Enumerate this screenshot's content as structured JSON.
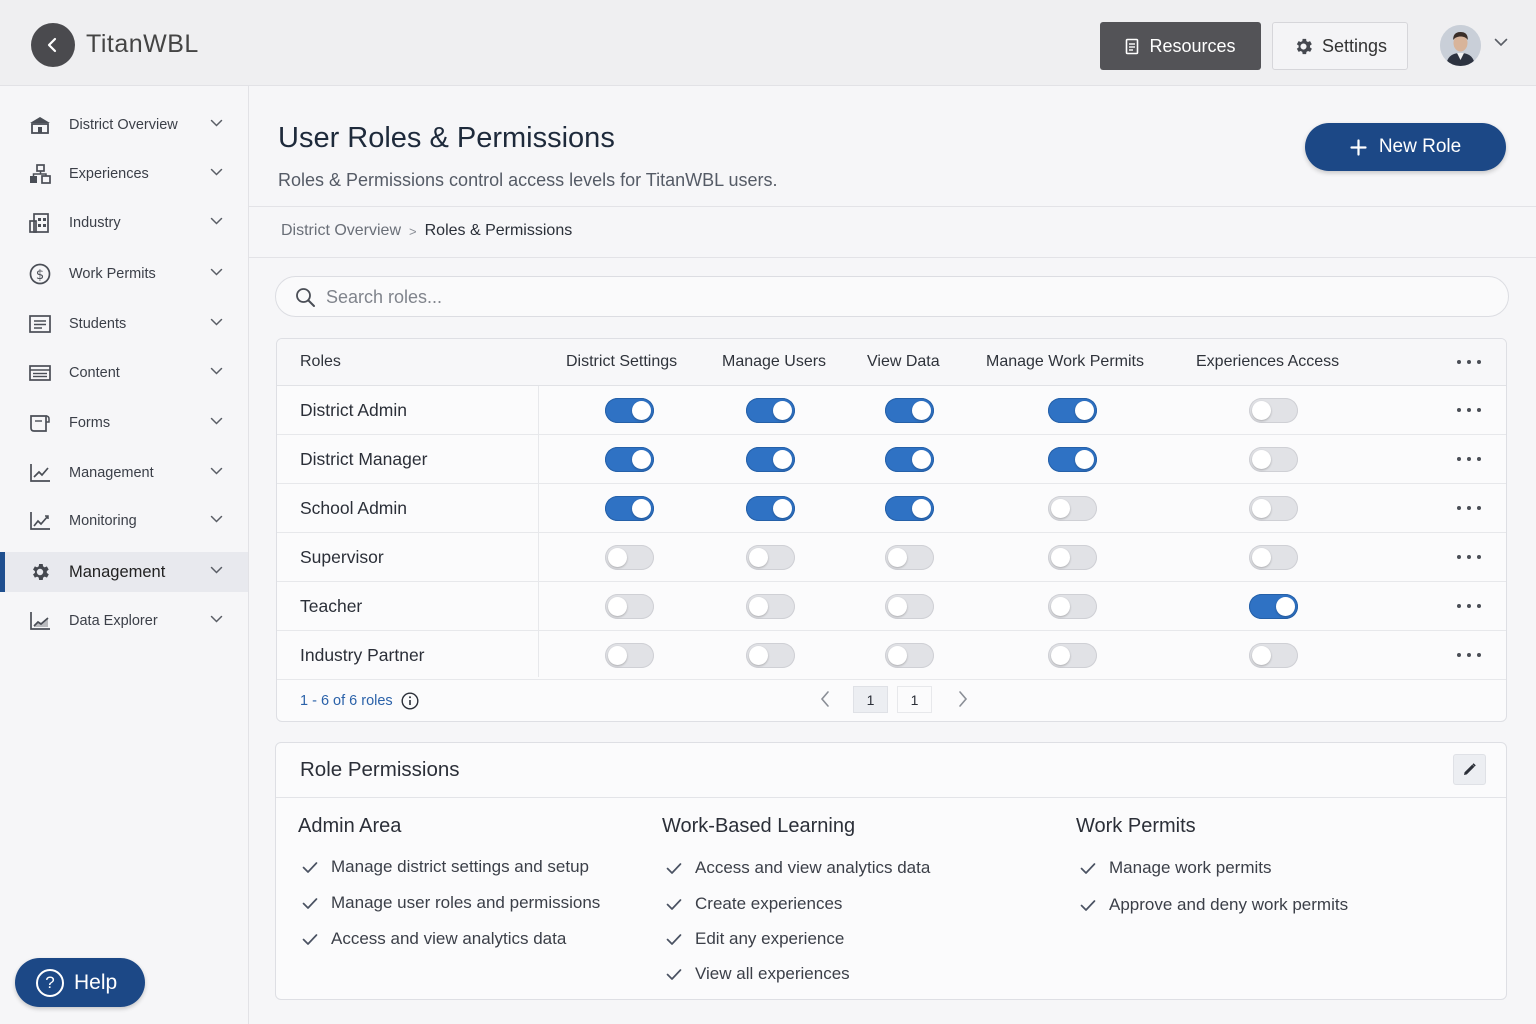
{
  "app": {
    "brand": "TitanWBL",
    "resources_label": "Resources",
    "settings_label": "Settings"
  },
  "sidebar": {
    "items": [
      {
        "label": "District Overview",
        "icon": "school-icon"
      },
      {
        "label": "Experiences",
        "icon": "network-icon"
      },
      {
        "label": "Industry",
        "icon": "building-icon"
      },
      {
        "label": "Work Permits",
        "icon": "dollar-icon"
      },
      {
        "label": "Students",
        "icon": "id-card-icon"
      },
      {
        "label": "Content",
        "icon": "content-icon"
      },
      {
        "label": "Forms",
        "icon": "forms-icon"
      },
      {
        "label": "Management",
        "icon": "line-chart-icon"
      },
      {
        "label": "Monitoring",
        "icon": "chart-icon"
      },
      {
        "label": "Management",
        "icon": "gear-icon",
        "active": true
      },
      {
        "label": "Data Explorer",
        "icon": "explorer-icon"
      }
    ],
    "help_label": "Help"
  },
  "page": {
    "title": "User Roles & Permissions",
    "subtitle": "Roles & Permissions control access levels for TitanWBL users.",
    "new_role_label": "New Role"
  },
  "breadcrumb": {
    "parent": "District Overview",
    "separator": ">",
    "current": "Roles & Permissions"
  },
  "search": {
    "placeholder": "Search roles..."
  },
  "table": {
    "columns": [
      "Roles",
      "District Settings",
      "Manage Users",
      "View Data",
      "Manage Work Permits",
      "Experiences Access"
    ],
    "rows": [
      {
        "name": "District Admin",
        "perms": [
          true,
          true,
          true,
          true,
          false
        ]
      },
      {
        "name": "District Manager",
        "perms": [
          true,
          true,
          true,
          true,
          false
        ]
      },
      {
        "name": "School Admin",
        "perms": [
          true,
          true,
          true,
          false,
          false
        ]
      },
      {
        "name": "Supervisor",
        "perms": [
          false,
          false,
          false,
          false,
          false
        ]
      },
      {
        "name": "Teacher",
        "perms": [
          false,
          false,
          false,
          false,
          true
        ]
      },
      {
        "name": "Industry Partner",
        "perms": [
          false,
          false,
          false,
          false,
          false
        ]
      }
    ],
    "count_label": "1 - 6 of 6 roles",
    "pages": [
      "1",
      "1"
    ]
  },
  "role_permissions": {
    "title": "Role Permissions",
    "groups": [
      {
        "title": "Admin Area",
        "items": [
          "Manage district settings and setup",
          "Manage user roles and permissions",
          "Access and view analytics data"
        ]
      },
      {
        "title": "Work-Based Learning",
        "items": [
          "Access and view analytics data",
          "Create experiences",
          "Edit any experience",
          "View all experiences"
        ]
      },
      {
        "title": "Work Permits",
        "items": [
          "Manage work permits",
          "Approve and deny work permits"
        ]
      }
    ]
  },
  "colors": {
    "primary": "#1c4886",
    "toggle_on": "#2f72c4",
    "toggle_off": "#e1e2e6"
  }
}
